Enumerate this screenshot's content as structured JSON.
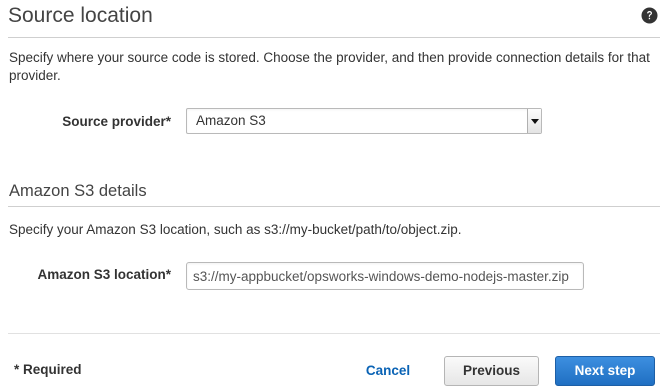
{
  "source_section": {
    "title": "Source location",
    "help_icon": "question-circle-icon",
    "description": "Specify where your source code is stored. Choose the provider, and then provide connection details for that provider.",
    "provider": {
      "label": "Source provider*",
      "selected": "Amazon S3"
    }
  },
  "s3_section": {
    "title": "Amazon S3 details",
    "description": "Specify your Amazon S3 location, such as s3://my-bucket/path/to/object.zip.",
    "location": {
      "label": "Amazon S3 location*",
      "value": "s3://my-appbucket/opsworks-windows-demo-nodejs-master.zip"
    }
  },
  "footer": {
    "required_note": "* Required",
    "cancel_label": "Cancel",
    "previous_label": "Previous",
    "next_label": "Next step"
  },
  "colors": {
    "primary_button": "#1f6fc2",
    "link": "#0a63b5",
    "heading": "#444444"
  }
}
